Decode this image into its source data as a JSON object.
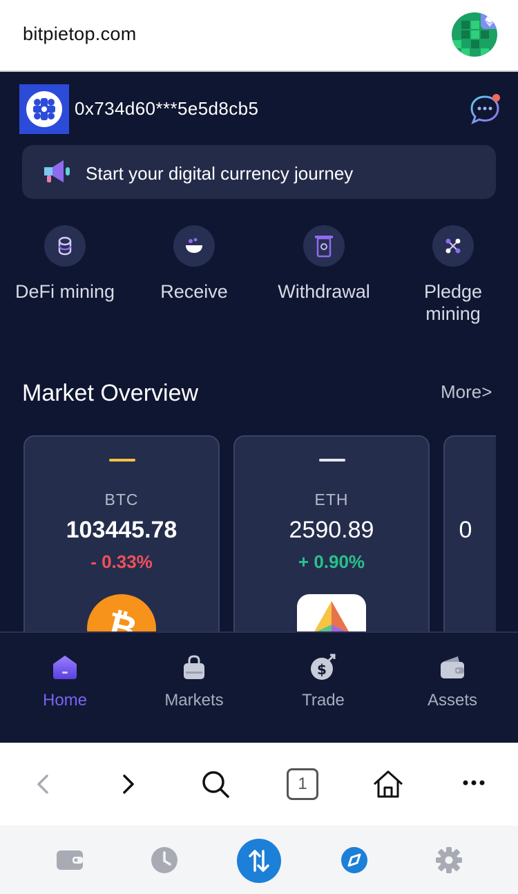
{
  "browser": {
    "url": "bitpietop.com",
    "tab_count": "1"
  },
  "header": {
    "address": "0x734d60***5e5d8cb5"
  },
  "banner": {
    "text": "Start your digital currency journey"
  },
  "actions": [
    {
      "label": "DeFi mining",
      "icon": "coin-stack-icon"
    },
    {
      "label": "Receive",
      "icon": "bowl-icon"
    },
    {
      "label": "Withdrawal",
      "icon": "withdrawal-icon"
    },
    {
      "label": "Pledge mining",
      "icon": "network-icon"
    }
  ],
  "market": {
    "title": "Market Overview",
    "more": "More>",
    "cards": [
      {
        "symbol": "BTC",
        "price": "103445.78",
        "change": "- 0.33%",
        "change_color": "#f0505a",
        "accent": "#f5c242"
      },
      {
        "symbol": "ETH",
        "price": "2590.89",
        "change": "+ 0.90%",
        "change_color": "#27c28a",
        "accent": "#e6e8ee"
      },
      {
        "symbol": "",
        "price": "0",
        "change": "",
        "change_color": "#27c28a",
        "accent": "#e6e8ee"
      }
    ]
  },
  "tabs": [
    {
      "label": "Home",
      "active": true
    },
    {
      "label": "Markets",
      "active": false
    },
    {
      "label": "Trade",
      "active": false
    },
    {
      "label": "Assets",
      "active": false
    }
  ],
  "colors": {
    "background": "#0f1631",
    "accent": "#7b63f0",
    "dock_primary": "#1c7fd8"
  }
}
